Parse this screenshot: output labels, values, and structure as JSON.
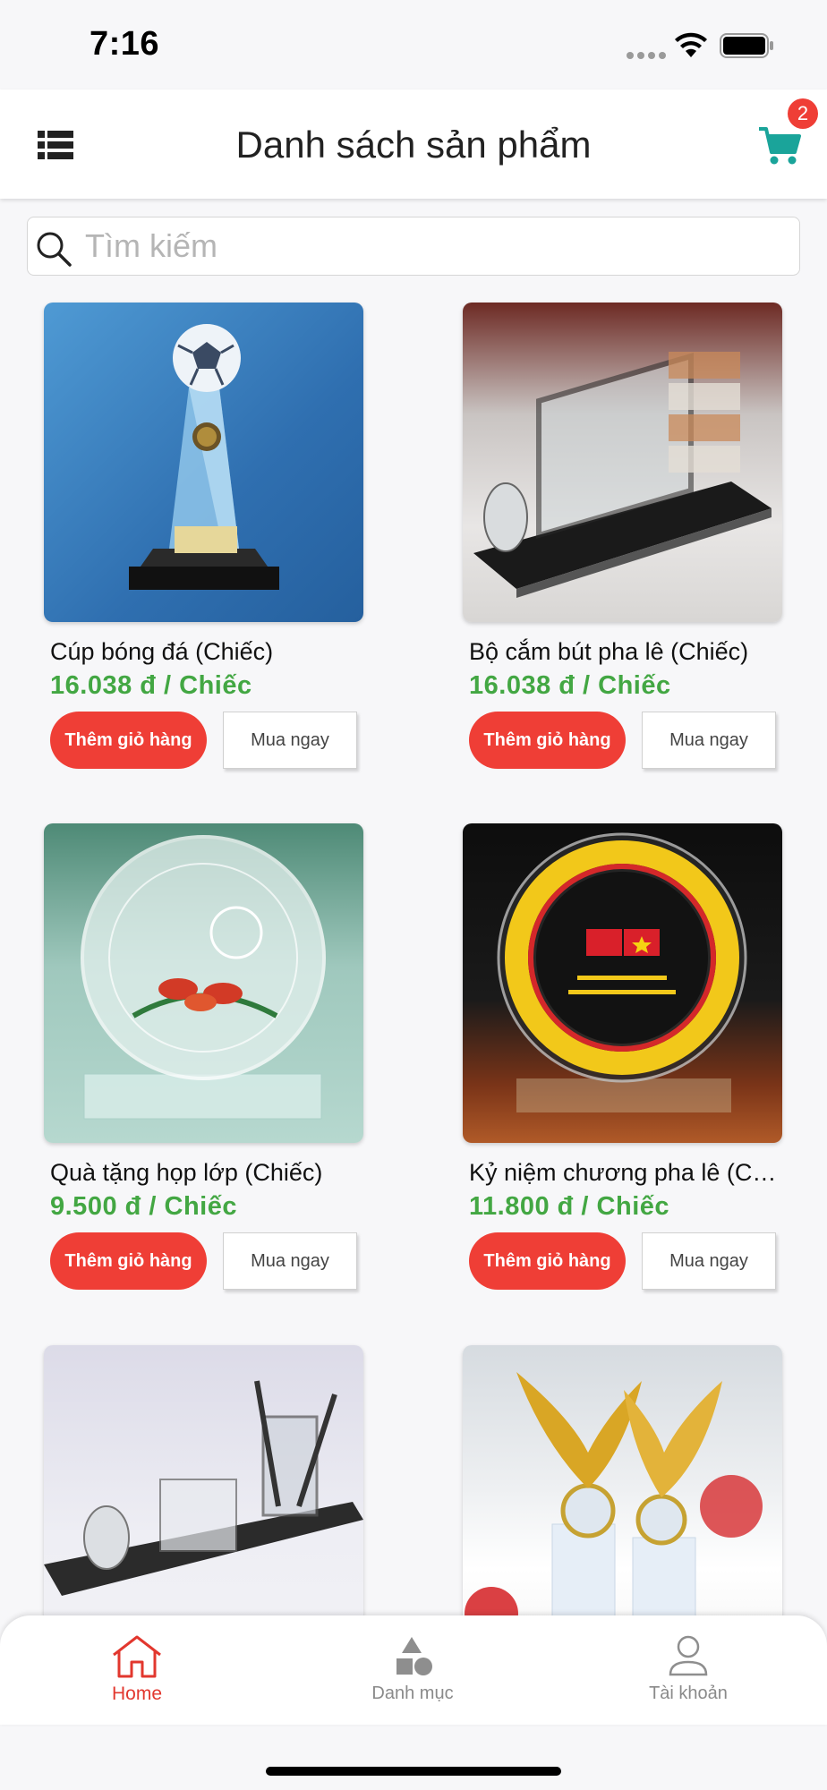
{
  "status_bar": {
    "time": "7:16"
  },
  "header": {
    "title": "Danh sách sản phẩm",
    "cart_count": "2"
  },
  "search": {
    "placeholder": "Tìm kiếm"
  },
  "products": [
    {
      "name": "Cúp bóng đá (Chiếc)",
      "price": "16.038 đ / Chiếc",
      "add_label": "Thêm giỏ hàng",
      "buy_label": "Mua ngay"
    },
    {
      "name": "Bộ cắm bút pha lê (Chiếc)",
      "price": "16.038 đ / Chiếc",
      "add_label": "Thêm giỏ hàng",
      "buy_label": "Mua ngay"
    },
    {
      "name": "Quà tặng họp lớp (Chiếc)",
      "price": "9.500 đ / Chiếc",
      "add_label": "Thêm giỏ hàng",
      "buy_label": "Mua ngay"
    },
    {
      "name": "Kỷ niệm chương pha lê (Ch...",
      "price": "11.800 đ / Chiếc",
      "add_label": "Thêm giỏ hàng",
      "buy_label": "Mua ngay"
    }
  ],
  "tabs": [
    {
      "label": "Home",
      "icon": "home-icon",
      "active": true
    },
    {
      "label": "Danh mục",
      "icon": "shapes-icon",
      "active": false
    },
    {
      "label": "Tài khoản",
      "icon": "user-icon",
      "active": false
    }
  ],
  "colors": {
    "accent_red": "#ef3e36",
    "price_green": "#43a743",
    "cart_teal": "#1aa49a",
    "active_tab": "#e2372e"
  }
}
